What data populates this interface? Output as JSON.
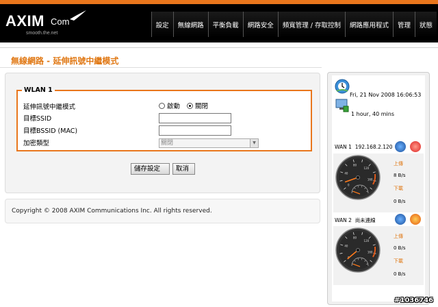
{
  "header": {
    "logo_brand": "AXIM",
    "logo_com": "Com",
    "logo_tag": "smooth.the.net",
    "nav": [
      "設定",
      "無線網路",
      "平衡負載",
      "網路安全",
      "頻寬管理 / 存取控制",
      "網路應用程式",
      "管理",
      "狀態"
    ]
  },
  "page": {
    "title": "無線網路 - 延伸訊號中繼模式"
  },
  "form": {
    "legend": "WLAN 1",
    "repeater_label": "延伸訊號中繼模式",
    "enable_label": "啟動",
    "disable_label": "關閉",
    "selected": "關閉",
    "ssid_label": "目標SSID",
    "ssid_value": "",
    "bssid_label": "目標BSSID (MAC)",
    "bssid_value": "",
    "encryption_label": "加密類型",
    "encryption_value": "關閉",
    "save_label": "儲存設定",
    "cancel_label": "取消"
  },
  "footer": {
    "copyright": "Copyright © 2008 AXIM Communications Inc. All rights reserved."
  },
  "status": {
    "datetime": "Fri, 21 Nov 2008 16:06:53",
    "uptime": "1 hour, 40 mins",
    "wan": [
      {
        "name": "WAN 1",
        "ip": "192.168.2.120",
        "up_label": "上傳",
        "up_rate": "8 B/s",
        "down_label": "下載",
        "down_rate": "0 B/s",
        "up_fraction": 0.08,
        "down_fraction": 0.0
      },
      {
        "name": "WAN 2",
        "ip": "尚未連線",
        "up_label": "上傳",
        "up_rate": "0 B/s",
        "down_label": "下載",
        "down_rate": "0 B/s",
        "up_fraction": 0.0,
        "down_fraction": 0.0
      }
    ],
    "gauge_ticks": [
      "0",
      "20",
      "40",
      "60",
      "80",
      "100",
      "120",
      "140",
      "160",
      "180"
    ],
    "sub_ticks": [
      "0",
      "20",
      "40",
      "60",
      "80",
      "100"
    ]
  },
  "watermark": "#1036746",
  "colors": {
    "accent": "#e9761c",
    "header": "#000000"
  },
  "icons": [
    "logo-bird-icon",
    "clock-icon",
    "network-monitor-icon",
    "wan-connect-icon",
    "wan-disconnect-icon",
    "dropdown-arrow-icon"
  ]
}
